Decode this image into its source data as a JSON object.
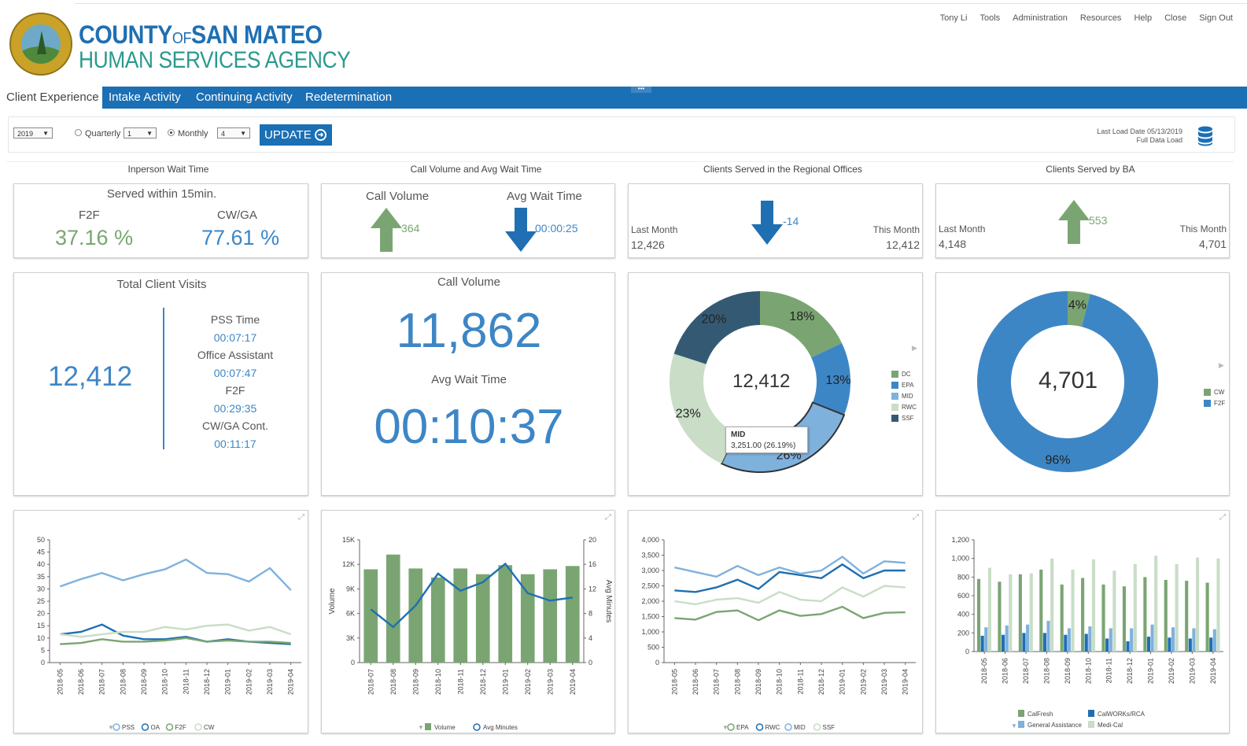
{
  "header": {
    "org_line1_a": "COUNTY",
    "org_line1_b": "OF",
    "org_line1_c": "SAN MATEO",
    "org_line2": "HUMAN SERVICES AGENCY",
    "seal_text": "COUNTY OF SAN MATEO CALIFORNIA",
    "nav": [
      "Tony Li",
      "Tools",
      "Administration",
      "Resources",
      "Help",
      "Close",
      "Sign Out"
    ]
  },
  "tabs": [
    "Client Experience",
    "Intake Activity",
    "Continuing Activity",
    "Redetermination"
  ],
  "filters": {
    "year": "2019",
    "quarterly_label": "Quarterly",
    "quarter_value": "1",
    "monthly_label": "Monthly",
    "month_value": "4",
    "update_label": "UPDATE",
    "last_load": "Last Load Date 05/13/2019",
    "full_load": "Full Data Load"
  },
  "sections": {
    "inperson": "Inperson Wait Time",
    "callvol": "Call Volume and Avg Wait Time",
    "regional": "Clients Served in the Regional Offices",
    "byba": "Clients Served by BA"
  },
  "kpi": {
    "served_title": "Served within 15min.",
    "f2f_label": "F2F",
    "f2f_value": "37.16 %",
    "cwga_label": "CW/GA",
    "cwga_value": "77.61 %",
    "call_volume_label": "Call Volume",
    "call_volume_delta": "364",
    "avg_wait_label": "Avg Wait Time",
    "avg_wait_delta": "00:00:25",
    "regional_last_label": "Last Month",
    "regional_last_value": "12,426",
    "regional_this_label": "This Month",
    "regional_this_value": "12,412",
    "regional_delta": "-14",
    "ba_last_label": "Last Month",
    "ba_last_value": "4,148",
    "ba_this_label": "This Month",
    "ba_this_value": "4,701",
    "ba_delta": "553"
  },
  "visits": {
    "title": "Total Client Visits",
    "total": "12,412",
    "items": [
      {
        "label": "PSS Time",
        "value": "00:07:17"
      },
      {
        "label": "Office Assistant",
        "value": "00:07:47"
      },
      {
        "label": "F2F",
        "value": "00:29:35"
      },
      {
        "label": "CW/GA Cont.",
        "value": "00:11:17"
      }
    ]
  },
  "callbig": {
    "title": "Call Volume",
    "value": "11,862",
    "wait_title": "Avg Wait Time",
    "wait_value": "00:10:37"
  },
  "colors": {
    "green": "#7aa572",
    "blue": "#3d86c6",
    "dark": "#345a73",
    "pale": "#c9ddc7",
    "light_blue": "#7fb1dd",
    "brand": "#1b6fb5"
  },
  "donut_regional": {
    "center": "12,412",
    "legend": [
      "DC",
      "EPA",
      "MID",
      "RWC",
      "SSF"
    ],
    "slices": [
      {
        "name": "DC",
        "pct": 18,
        "label": "18%"
      },
      {
        "name": "EPA",
        "pct": 13,
        "label": "13%"
      },
      {
        "name": "MID",
        "pct": 26,
        "label": "26%"
      },
      {
        "name": "RWC",
        "pct": 23,
        "label": "23%"
      },
      {
        "name": "SSF",
        "pct": 20,
        "label": "20%"
      }
    ],
    "tooltip_name": "MID",
    "tooltip_value": "3,251.00 (26.19%)"
  },
  "donut_ba": {
    "center": "4,701",
    "legend": [
      "CW",
      "F2F"
    ],
    "slices": [
      {
        "name": "CW",
        "pct": 4,
        "label": "4%"
      },
      {
        "name": "F2F",
        "pct": 96,
        "label": "96%"
      }
    ]
  },
  "chart_data": [
    {
      "type": "line",
      "x": [
        "2018-05",
        "2018-06",
        "2018-07",
        "2018-08",
        "2018-09",
        "2018-10",
        "2018-11",
        "2018-12",
        "2019-01",
        "2019-02",
        "2019-03",
        "2019-04"
      ],
      "ylim": [
        0,
        50
      ],
      "yticks": [
        "0",
        "5",
        "10",
        "15",
        "20",
        "25",
        "30",
        "35",
        "40",
        "45",
        "50"
      ],
      "series": [
        {
          "name": "PSS",
          "values": [
            31,
            34,
            36.5,
            33.5,
            36,
            38,
            42,
            36.5,
            36,
            33,
            38.5,
            29.5
          ]
        },
        {
          "name": "OA",
          "values": [
            11.5,
            12.5,
            15.5,
            11,
            9.5,
            9.5,
            10.5,
            8.5,
            9.5,
            8.5,
            8,
            7.5
          ]
        },
        {
          "name": "F2F",
          "values": [
            7.5,
            8,
            9.5,
            8.5,
            8.5,
            9,
            10,
            8.5,
            9,
            8.5,
            8.5,
            8
          ]
        },
        {
          "name": "CW",
          "values": [
            11.5,
            10.5,
            11.5,
            12.5,
            12.5,
            14.5,
            13.5,
            15,
            15.5,
            13,
            14.5,
            11.5
          ]
        }
      ]
    },
    {
      "type": "bar",
      "x": [
        "2018-07",
        "2018-08",
        "2018-09",
        "2018-10",
        "2018-11",
        "2018-12",
        "2019-01",
        "2019-02",
        "2019-03",
        "2019-04"
      ],
      "ylim": [
        0,
        15000
      ],
      "yticks": [
        "0",
        "3K",
        "6K",
        "9K",
        "12K",
        "15K"
      ],
      "y2lim": [
        0,
        20
      ],
      "y2ticks": [
        "0",
        "4",
        "8",
        "12",
        "16",
        "20"
      ],
      "ylabel": "Volume",
      "y2label": "Avg Minutes",
      "series": [
        {
          "name": "Volume",
          "values": [
            11400,
            13200,
            11500,
            10400,
            11500,
            10800,
            11900,
            10800,
            11400,
            11800
          ]
        },
        {
          "name": "Avg Minutes",
          "values": [
            8.7,
            5.8,
            9.3,
            14.5,
            11.7,
            13.1,
            16.1,
            11.3,
            10.1,
            10.6
          ]
        }
      ]
    },
    {
      "type": "line",
      "x": [
        "2018-05",
        "2018-06",
        "2018-07",
        "2018-08",
        "2018-09",
        "2018-10",
        "2018-11",
        "2018-12",
        "2019-01",
        "2019-02",
        "2019-03",
        "2019-04"
      ],
      "ylim": [
        0,
        4000
      ],
      "yticks": [
        "0",
        "500",
        "1,000",
        "1,500",
        "2,000",
        "2,500",
        "3,000",
        "3,500",
        "4,000"
      ],
      "series": [
        {
          "name": "EPA",
          "values": [
            1450,
            1400,
            1650,
            1700,
            1380,
            1700,
            1520,
            1580,
            1820,
            1450,
            1620,
            1640
          ]
        },
        {
          "name": "RWC",
          "values": [
            2350,
            2300,
            2450,
            2700,
            2400,
            2950,
            2850,
            2750,
            3200,
            2750,
            3000,
            3000
          ]
        },
        {
          "name": "MID",
          "values": [
            3100,
            2950,
            2800,
            3150,
            2850,
            3100,
            2900,
            3000,
            3450,
            2900,
            3300,
            3250
          ]
        },
        {
          "name": "SSF",
          "values": [
            2000,
            1900,
            2050,
            2100,
            1950,
            2300,
            2050,
            2000,
            2450,
            2150,
            2500,
            2450
          ]
        }
      ]
    },
    {
      "type": "bar",
      "x": [
        "2018-05",
        "2018-06",
        "2018-07",
        "2018-08",
        "2018-09",
        "2018-10",
        "2018-11",
        "2018-12",
        "2019-01",
        "2019-02",
        "2019-03",
        "2019-04"
      ],
      "ylim": [
        0,
        1200
      ],
      "yticks": [
        "0",
        "200",
        "400",
        "600",
        "800",
        "1,000",
        "1,200"
      ],
      "series": [
        {
          "name": "CalFresh",
          "values": [
            780,
            750,
            830,
            880,
            720,
            790,
            720,
            700,
            800,
            770,
            760,
            740
          ]
        },
        {
          "name": "CalWORKs/RCA",
          "values": [
            170,
            180,
            200,
            200,
            180,
            190,
            140,
            110,
            160,
            150,
            140,
            150
          ]
        },
        {
          "name": "General Assistance",
          "values": [
            260,
            280,
            290,
            330,
            250,
            270,
            250,
            250,
            290,
            260,
            250,
            240
          ]
        },
        {
          "name": "Medi-Cal",
          "values": [
            900,
            830,
            840,
            1000,
            880,
            990,
            870,
            940,
            1030,
            940,
            1010,
            1000
          ]
        }
      ]
    }
  ]
}
